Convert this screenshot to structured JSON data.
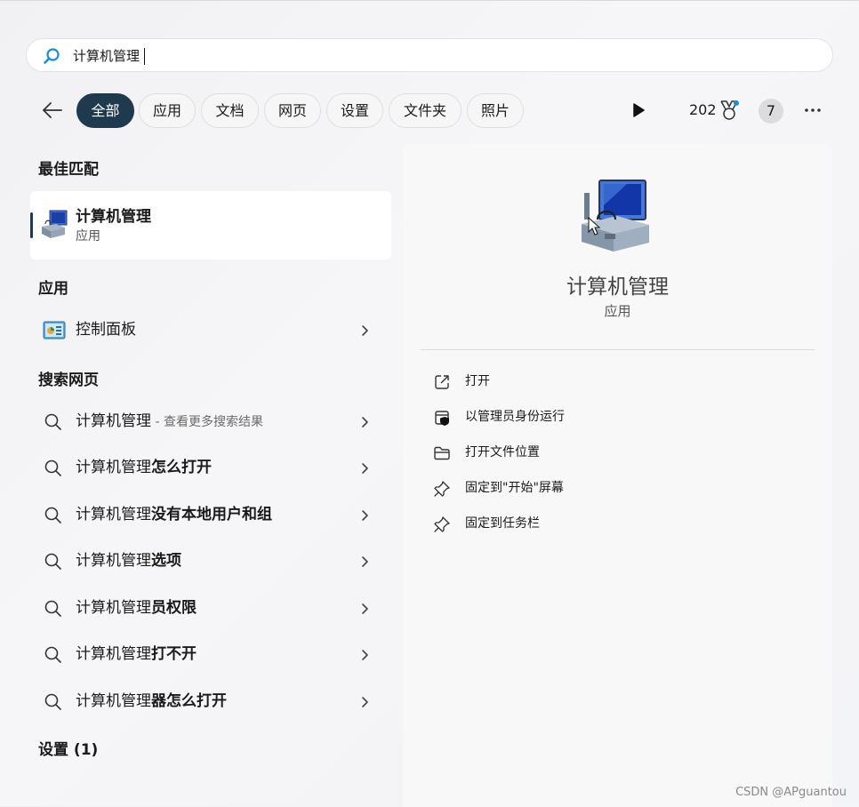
{
  "search": {
    "value": "计算机管理"
  },
  "filters": [
    {
      "label": "全部",
      "active": true
    },
    {
      "label": "应用"
    },
    {
      "label": "文档"
    },
    {
      "label": "网页"
    },
    {
      "label": "设置"
    },
    {
      "label": "文件夹"
    },
    {
      "label": "照片"
    }
  ],
  "toolbar": {
    "points": "202",
    "count": "7"
  },
  "best_match": {
    "title": "最佳匹配",
    "name": "计算机管理",
    "type": "应用"
  },
  "apps": {
    "title": "应用",
    "items": [
      {
        "label": "控制面板"
      }
    ]
  },
  "web": {
    "title": "搜索网页",
    "items": [
      {
        "prefix": "计算机管理",
        "hint": " - 查看更多搜索结果"
      },
      {
        "prefix": "计算机管理",
        "bold": "怎么打开"
      },
      {
        "prefix": "计算机管理",
        "bold": "没有本地用户和组"
      },
      {
        "prefix": "计算机管理",
        "bold": "选项"
      },
      {
        "prefix": "计算机管理",
        "bold": "员权限"
      },
      {
        "prefix": "计算机管理",
        "bold": "打不开"
      },
      {
        "prefix": "计算机管理",
        "bold": "器怎么打开"
      }
    ]
  },
  "settings_section": {
    "title": "设置 (1)"
  },
  "detail": {
    "name": "计算机管理",
    "type": "应用",
    "actions": [
      {
        "label": "打开",
        "icon": "open-external-icon"
      },
      {
        "label": "以管理员身份运行",
        "icon": "run-as-admin-icon"
      },
      {
        "label": "打开文件位置",
        "icon": "folder-icon"
      },
      {
        "label": "固定到\"开始\"屏幕",
        "icon": "pin-icon"
      },
      {
        "label": "固定到任务栏",
        "icon": "pin-icon"
      }
    ]
  },
  "watermark": "CSDN @APguantou",
  "colors": {
    "accent": "#1f3a4d",
    "search_icon": "#1a8fd6"
  }
}
